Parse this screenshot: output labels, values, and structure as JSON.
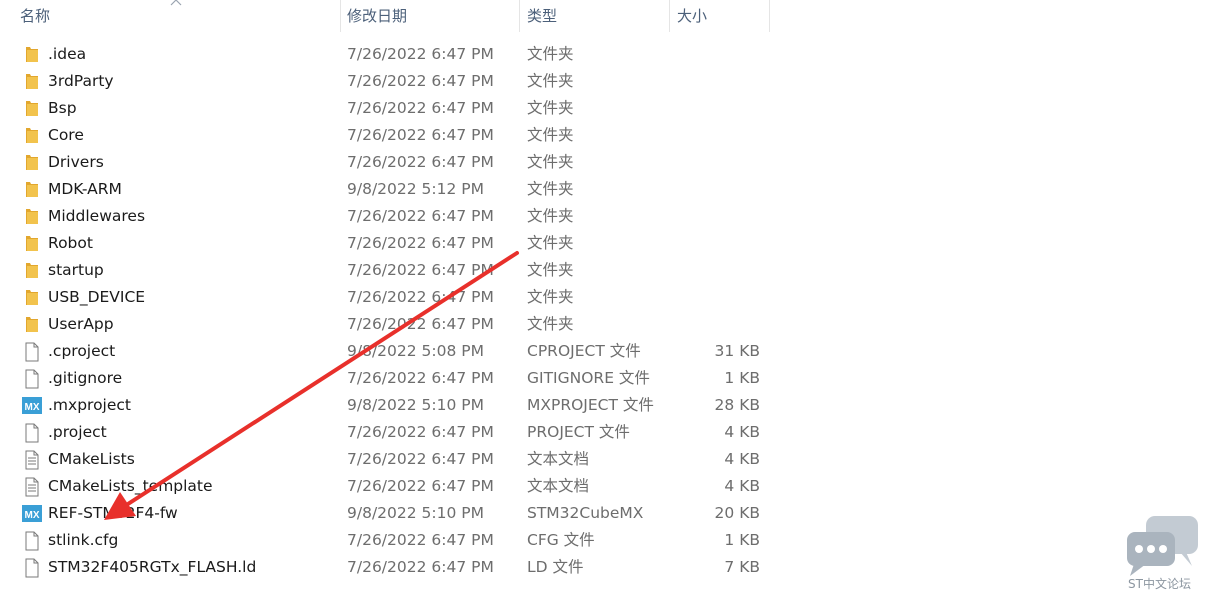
{
  "header": {
    "name": "名称",
    "date": "修改日期",
    "type": "类型",
    "size": "大小"
  },
  "files": [
    {
      "icon": "folder-icon",
      "name": ".idea",
      "date": "7/26/2022 6:47 PM",
      "type": "文件夹",
      "size": ""
    },
    {
      "icon": "folder-icon",
      "name": "3rdParty",
      "date": "7/26/2022 6:47 PM",
      "type": "文件夹",
      "size": ""
    },
    {
      "icon": "folder-icon",
      "name": "Bsp",
      "date": "7/26/2022 6:47 PM",
      "type": "文件夹",
      "size": ""
    },
    {
      "icon": "folder-icon",
      "name": "Core",
      "date": "7/26/2022 6:47 PM",
      "type": "文件夹",
      "size": ""
    },
    {
      "icon": "folder-icon",
      "name": "Drivers",
      "date": "7/26/2022 6:47 PM",
      "type": "文件夹",
      "size": ""
    },
    {
      "icon": "folder-icon",
      "name": "MDK-ARM",
      "date": "9/8/2022 5:12 PM",
      "type": "文件夹",
      "size": ""
    },
    {
      "icon": "folder-icon",
      "name": "Middlewares",
      "date": "7/26/2022 6:47 PM",
      "type": "文件夹",
      "size": ""
    },
    {
      "icon": "folder-icon",
      "name": "Robot",
      "date": "7/26/2022 6:47 PM",
      "type": "文件夹",
      "size": ""
    },
    {
      "icon": "folder-icon",
      "name": "startup",
      "date": "7/26/2022 6:47 PM",
      "type": "文件夹",
      "size": ""
    },
    {
      "icon": "folder-icon",
      "name": "USB_DEVICE",
      "date": "7/26/2022 6:47 PM",
      "type": "文件夹",
      "size": ""
    },
    {
      "icon": "folder-icon",
      "name": "UserApp",
      "date": "7/26/2022 6:47 PM",
      "type": "文件夹",
      "size": ""
    },
    {
      "icon": "file-icon",
      "name": ".cproject",
      "date": "9/8/2022 5:08 PM",
      "type": "CPROJECT 文件",
      "size": "31 KB"
    },
    {
      "icon": "file-icon",
      "name": ".gitignore",
      "date": "7/26/2022 6:47 PM",
      "type": "GITIGNORE 文件",
      "size": "1 KB"
    },
    {
      "icon": "mx-icon",
      "name": ".mxproject",
      "date": "9/8/2022 5:10 PM",
      "type": "MXPROJECT 文件",
      "size": "28 KB"
    },
    {
      "icon": "file-icon",
      "name": ".project",
      "date": "7/26/2022 6:47 PM",
      "type": "PROJECT 文件",
      "size": "4 KB"
    },
    {
      "icon": "text-file-icon",
      "name": "CMakeLists",
      "date": "7/26/2022 6:47 PM",
      "type": "文本文档",
      "size": "4 KB"
    },
    {
      "icon": "text-file-icon",
      "name": "CMakeLists_template",
      "date": "7/26/2022 6:47 PM",
      "type": "文本文档",
      "size": "4 KB"
    },
    {
      "icon": "mx-icon",
      "name": "REF-STM32F4-fw",
      "date": "9/8/2022 5:10 PM",
      "type": "STM32CubeMX",
      "size": "20 KB"
    },
    {
      "icon": "file-icon",
      "name": "stlink.cfg",
      "date": "7/26/2022 6:47 PM",
      "type": "CFG 文件",
      "size": "1 KB"
    },
    {
      "icon": "file-icon",
      "name": "STM32F405RGTx_FLASH.ld",
      "date": "7/26/2022 6:47 PM",
      "type": "LD 文件",
      "size": "7 KB"
    }
  ],
  "icons": {
    "mx_label": "MX"
  },
  "watermark": {
    "text": "ST中文论坛"
  },
  "colors": {
    "header_text": "#4c607a",
    "folder": "#f2c34d",
    "mx_badge": "#3a9fd6",
    "arrow": "#e8302b"
  }
}
